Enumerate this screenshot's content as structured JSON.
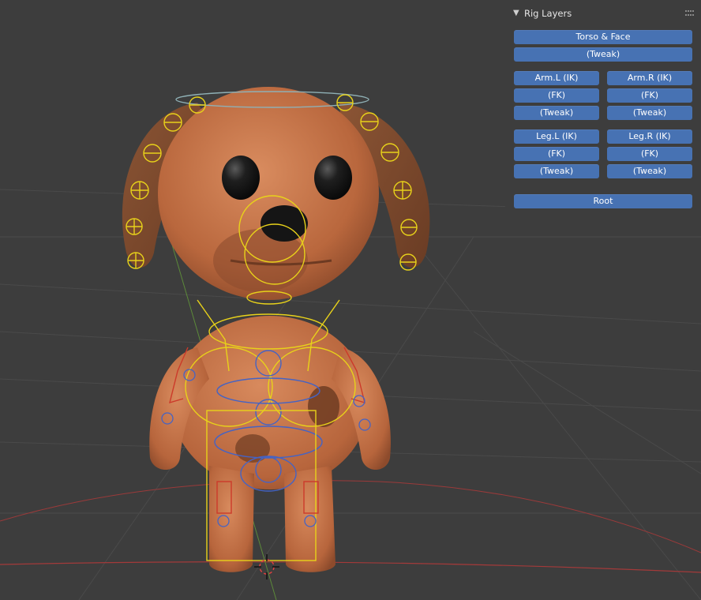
{
  "panel": {
    "title": "Rig Layers",
    "collapse_icon": "chevron-down-icon",
    "drag_icon": "drag-handle-icon",
    "accent_color": "#4772b3"
  },
  "buttons": {
    "torso_face": "Torso & Face",
    "torso_tweak": "(Tweak)",
    "arm_l_ik": "Arm.L (IK)",
    "arm_r_ik": "Arm.R (IK)",
    "arm_l_fk": "(FK)",
    "arm_r_fk": "(FK)",
    "arm_l_tweak": "(Tweak)",
    "arm_r_tweak": "(Tweak)",
    "leg_l_ik": "Leg.L (IK)",
    "leg_r_ik": "Leg.R (IK)",
    "leg_l_fk": "(FK)",
    "leg_r_fk": "(FK)",
    "leg_l_tweak": "(Tweak)",
    "leg_r_tweak": "(Tweak)",
    "root": "Root"
  },
  "viewport": {
    "subject": "dog-character-rig",
    "bone_color": "#e8d21a",
    "cursor_icon": "3d-cursor-icon"
  }
}
